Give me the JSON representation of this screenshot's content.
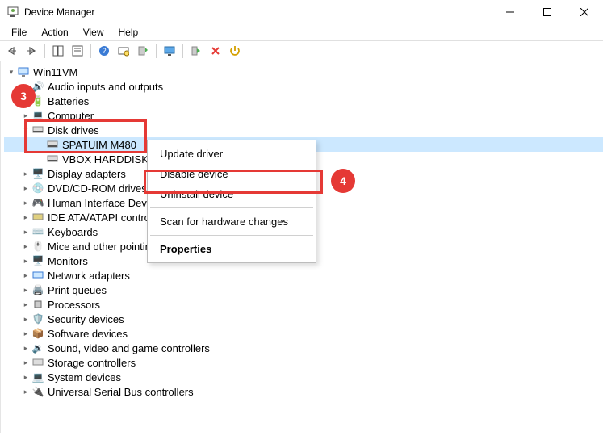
{
  "window": {
    "title": "Device Manager"
  },
  "menubar": [
    "File",
    "Action",
    "View",
    "Help"
  ],
  "root_name": "Win11VM",
  "categories": {
    "audio": "Audio inputs and outputs",
    "batteries": "Batteries",
    "computer": "Computer",
    "disk_drives": "Disk drives",
    "disk_item_1": "SPATUIM M480",
    "disk_item_2": "VBOX HARDDISK",
    "display": "Display adapters",
    "dvd": "DVD/CD-ROM drives",
    "hid": "Human Interface Dev",
    "ide": "IDE ATA/ATAPI contro",
    "keyboards": "Keyboards",
    "mice": "Mice and other pointing devices",
    "monitors": "Monitors",
    "network": "Network adapters",
    "printq": "Print queues",
    "processors": "Processors",
    "security": "Security devices",
    "software": "Software devices",
    "sound": "Sound, video and game controllers",
    "storage": "Storage controllers",
    "system": "System devices",
    "usb": "Universal Serial Bus controllers"
  },
  "context_menu": {
    "update": "Update driver",
    "disable": "Disable device",
    "uninstall": "Uninstall device",
    "scan": "Scan for hardware changes",
    "properties": "Properties"
  },
  "annotations": {
    "badge3": "3",
    "badge4": "4"
  }
}
